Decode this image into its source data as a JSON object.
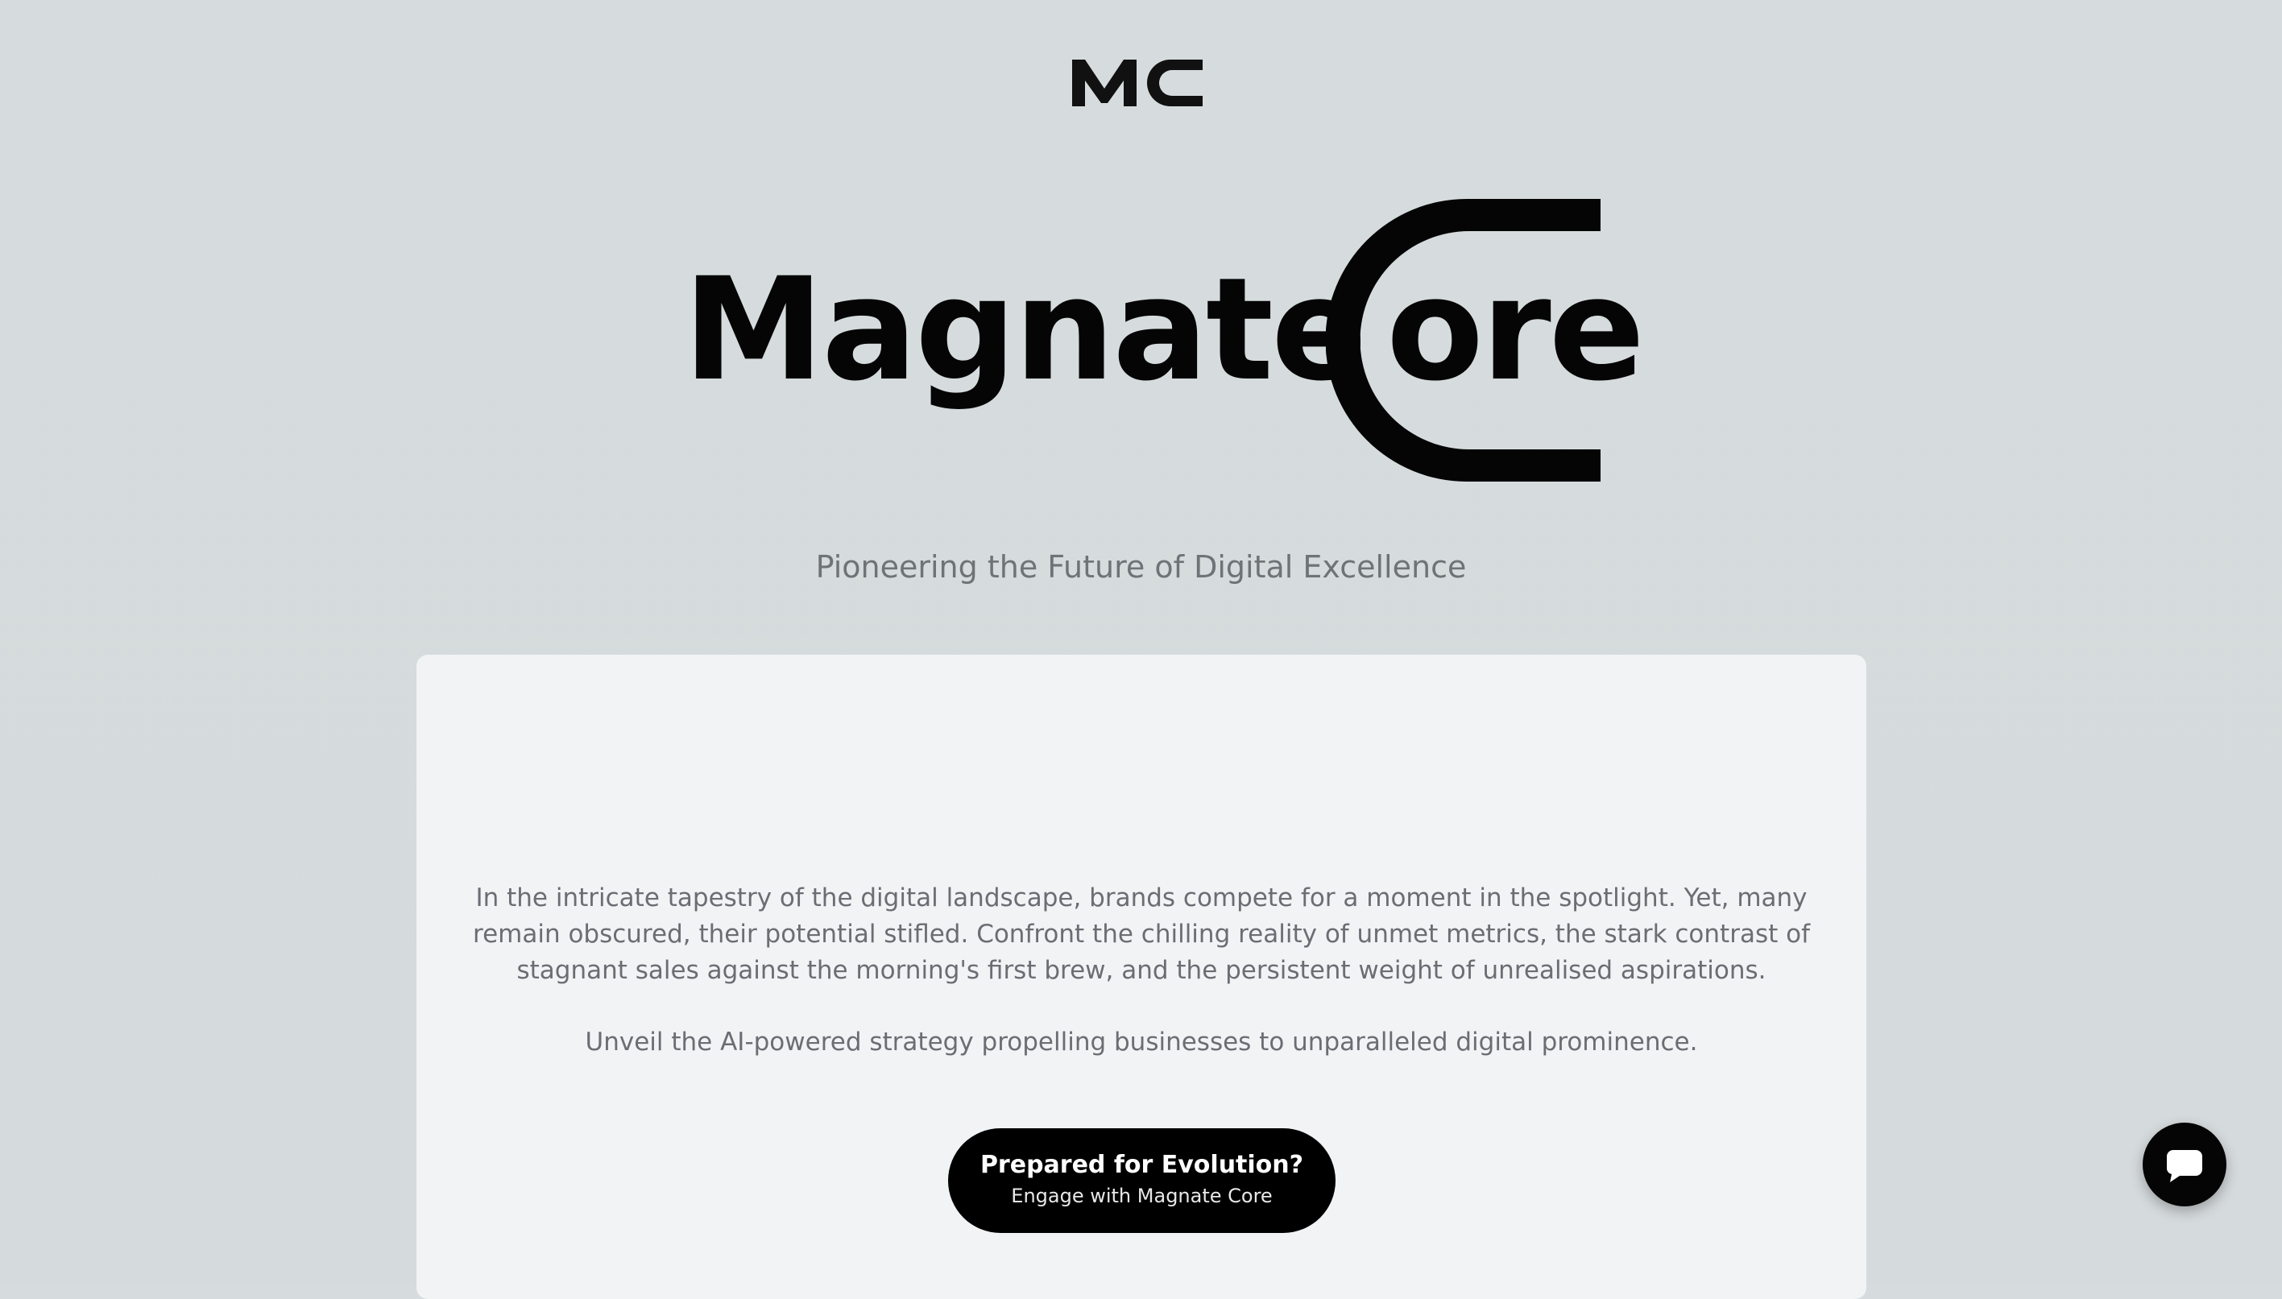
{
  "brand": {
    "monogram": "MC",
    "title_word": "Magnate",
    "title_c": "C",
    "title_rest": "ore"
  },
  "hero": {
    "tagline": "Pioneering the Future of Digital Excellence"
  },
  "card": {
    "paragraph_1": "In the intricate tapestry of the digital landscape, brands compete for a moment in the spotlight. Yet, many remain obscured, their potential stifled. Confront the chilling reality of unmet metrics, the stark contrast of stagnant sales against the morning's first brew, and the persistent weight of unrealised aspirations.",
    "paragraph_2": "Unveil the AI-powered strategy propelling businesses to unparalleled digital prominence.",
    "cta_title": "Prepared for Evolution?",
    "cta_subtitle": "Engage with Magnate Core"
  },
  "chat": {
    "icon": "chat-bubble-icon"
  },
  "colors": {
    "background": "#d6dcdd",
    "card": "#f1f3f5",
    "ink": "#050505",
    "muted_text": "#6a6e73"
  }
}
